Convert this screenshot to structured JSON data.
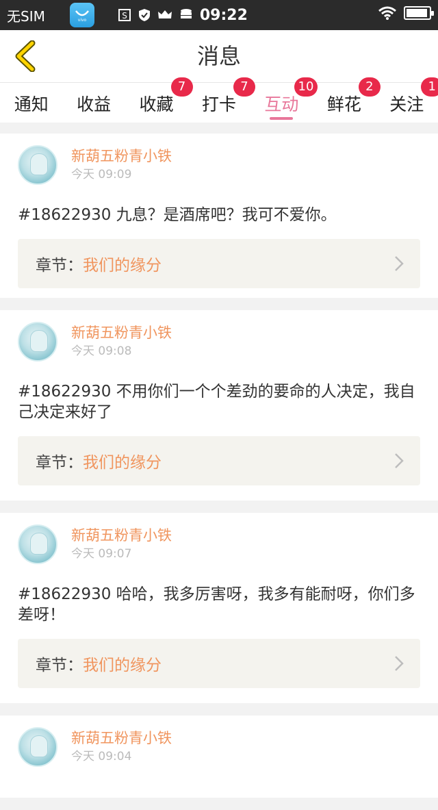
{
  "status_bar": {
    "carrier": "无SIM",
    "time": "09:22",
    "app_icon_label": "vivo",
    "battery_level": 0.95
  },
  "header": {
    "title": "消息"
  },
  "tabs": [
    {
      "label": "通知",
      "badge": ""
    },
    {
      "label": "收益",
      "badge": ""
    },
    {
      "label": "收藏",
      "badge": "7"
    },
    {
      "label": "打卡",
      "badge": "7"
    },
    {
      "label": "互动",
      "badge": "10",
      "active": true
    },
    {
      "label": "鲜花",
      "badge": "2"
    },
    {
      "label": "关注",
      "badge": "1"
    }
  ],
  "messages": [
    {
      "user": "新葫五粉青小铁",
      "time": "今天 09:09",
      "text": "#18622930 九息？是酒席吧？我可不爱你。",
      "chapter_label": "章节：",
      "chapter": "我们的缘分"
    },
    {
      "user": "新葫五粉青小铁",
      "time": "今天 09:08",
      "text": "#18622930 不用你们一个个差劲的要命的人决定，我自己决定来好了",
      "chapter_label": "章节：",
      "chapter": "我们的缘分"
    },
    {
      "user": "新葫五粉青小铁",
      "time": "今天 09:07",
      "text": "#18622930 哈哈，我多厉害呀，我多有能耐呀，你们多差呀！",
      "chapter_label": "章节：",
      "chapter": "我们的缘分"
    },
    {
      "user": "新葫五粉青小铁",
      "time": "今天 09:04",
      "text": "",
      "chapter_label": "",
      "chapter": ""
    }
  ],
  "colors": {
    "accent_tab": "#e8779a",
    "username": "#f0955e",
    "badge": "#e8294a",
    "back_arrow": "#e0b800"
  }
}
